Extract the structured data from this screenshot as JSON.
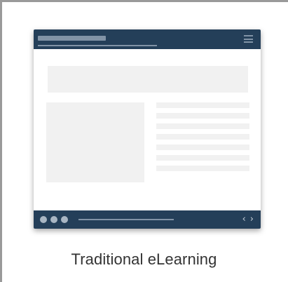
{
  "tile": {
    "caption": "Traditional eLearning"
  },
  "preview": {
    "menu_icon": "hamburger-menu-icon",
    "dots_icon": "dots-icon",
    "nav_prev_icon": "chevron-left-icon",
    "nav_next_icon": "chevron-right-icon",
    "nav_prev_glyph": "‹",
    "nav_next_glyph": "›",
    "colors": {
      "bar": "#243f59",
      "bar_accent": "#8193a6",
      "placeholder": "#f1f1f1",
      "caption_text": "#333333"
    }
  }
}
